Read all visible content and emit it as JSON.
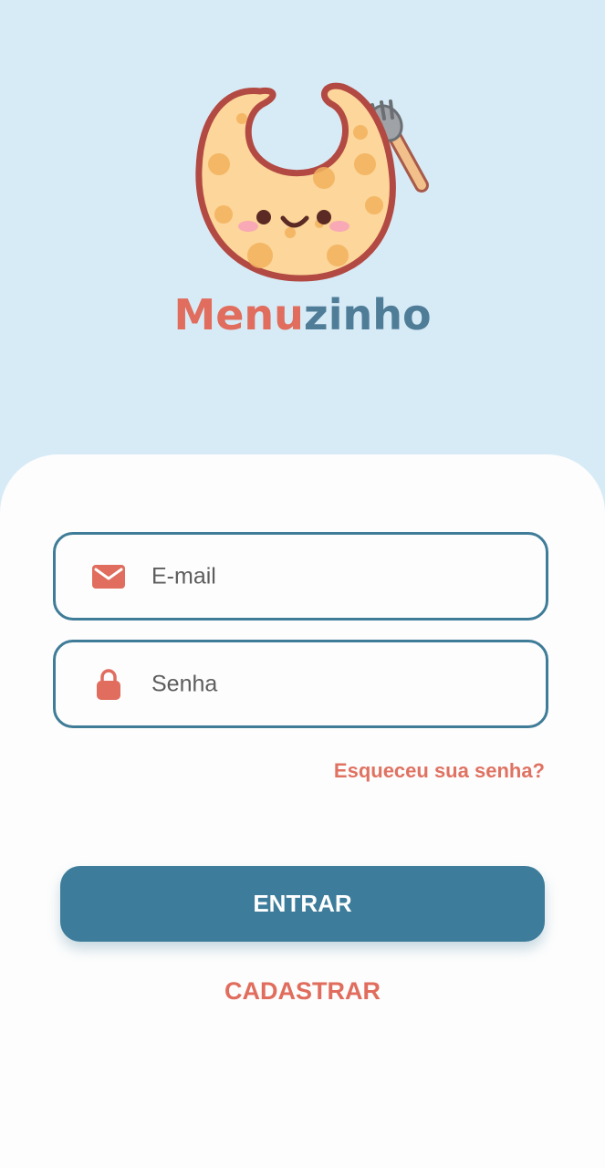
{
  "brand": {
    "name_part1": "Menu",
    "name_part2": "zinho"
  },
  "form": {
    "email_placeholder": "E-mail",
    "password_placeholder": "Senha",
    "forgot_label": "Esqueceu sua senha?",
    "enter_label": "ENTRAR",
    "register_label": "CADASTRAR"
  },
  "icons": {
    "logo": "bib-mascot-logo",
    "email": "envelope-icon",
    "password": "lock-icon"
  },
  "colors": {
    "background": "#d7ebf7",
    "accent_red": "#e06d5d",
    "accent_blue": "#3d7c9a",
    "card": "#fdfdfd"
  }
}
